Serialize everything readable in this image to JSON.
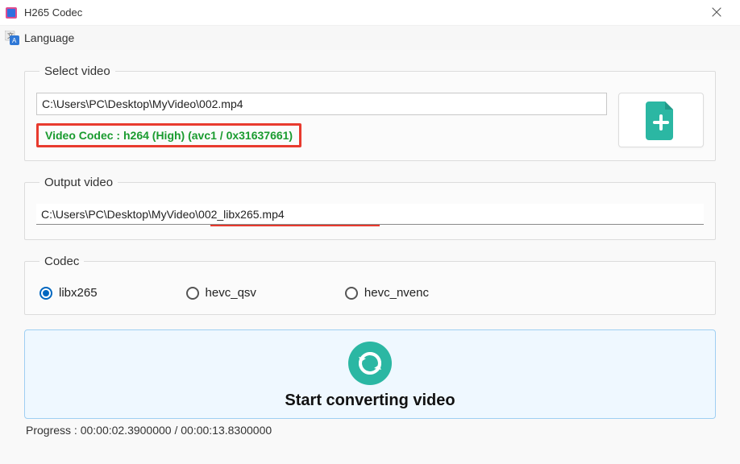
{
  "window": {
    "title": "H265 Codec",
    "close_label": "✕"
  },
  "menu": {
    "language_label": "Language"
  },
  "select_video": {
    "legend": "Select video",
    "input_value": "C:\\Users\\PC\\Desktop\\MyVideo\\002.mp4",
    "codec_info": "Video Codec : h264 (High) (avc1 / 0x31637661)"
  },
  "output_video": {
    "legend": "Output video",
    "input_value": "C:\\Users\\PC\\Desktop\\MyVideo\\002_libx265.mp4"
  },
  "codec": {
    "legend": "Codec",
    "options": [
      {
        "label": "libx265",
        "selected": true
      },
      {
        "label": "hevc_qsv",
        "selected": false
      },
      {
        "label": "hevc_nvenc",
        "selected": false
      }
    ]
  },
  "action": {
    "start_label": "Start converting video"
  },
  "progress": {
    "text": "Progress : 00:00:02.3900000 / 00:00:13.8300000"
  },
  "colors": {
    "accent_teal": "#2bb7a3",
    "highlight_red": "#e83a2e",
    "success_green": "#1a9b2f",
    "panel_border_blue": "#9fcff2",
    "panel_bg_blue": "#eff8ff",
    "radio_blue": "#0067c0"
  },
  "icons": {
    "app": "app-icon",
    "language": "translate-icon",
    "add_file": "file-plus-icon",
    "convert": "refresh-circle-icon",
    "close": "close-icon"
  }
}
